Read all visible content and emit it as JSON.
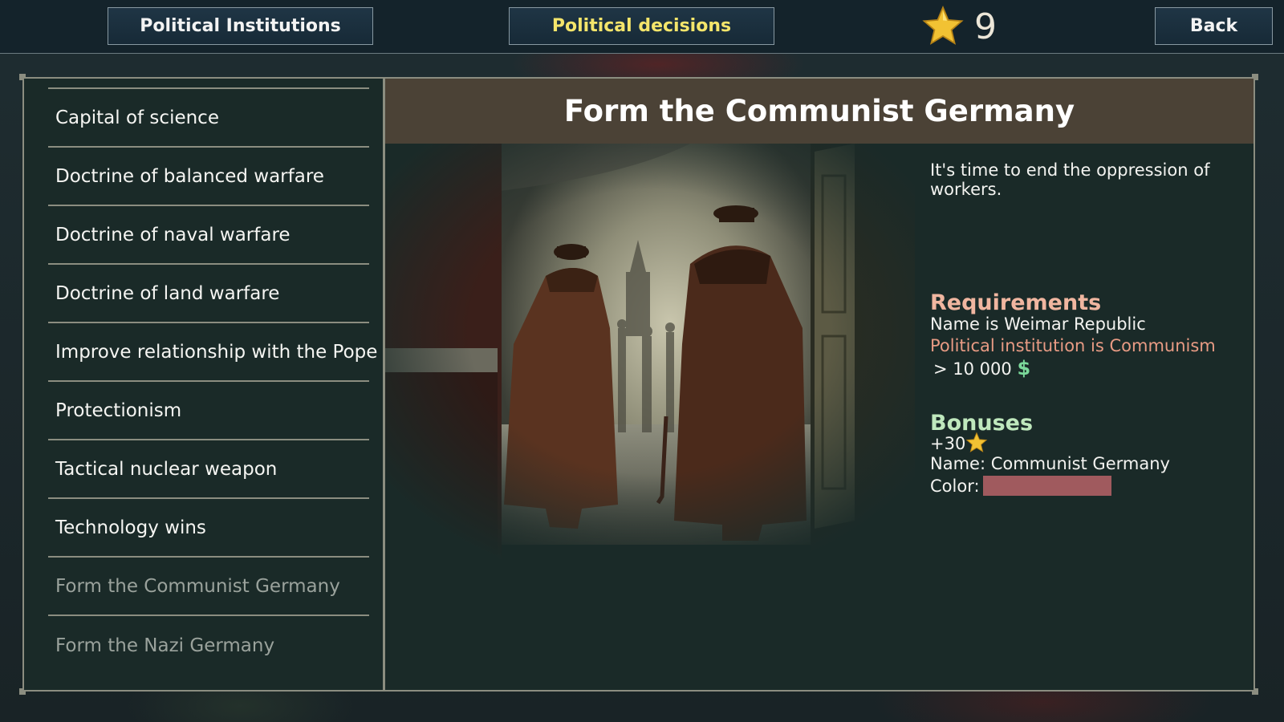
{
  "top_bar": {
    "institutions_label": "Political Institutions",
    "decisions_label": "Political decisions",
    "stars_count": "9",
    "back_label": "Back",
    "star_icon": "star-icon"
  },
  "decisions_list": [
    {
      "label": "Capital of science",
      "available": true
    },
    {
      "label": "Doctrine of balanced warfare",
      "available": true
    },
    {
      "label": "Doctrine of naval warfare",
      "available": true
    },
    {
      "label": "Doctrine of land warfare",
      "available": true
    },
    {
      "label": "Improve relationship with the Pope",
      "available": true
    },
    {
      "label": "Protectionism",
      "available": true
    },
    {
      "label": "Tactical nuclear weapon",
      "available": true
    },
    {
      "label": "Technology wins",
      "available": true
    },
    {
      "label": "Form the Communist Germany",
      "available": false
    },
    {
      "label": "Form the Nazi Germany",
      "available": false
    }
  ],
  "detail": {
    "title": "Form the Communist Germany",
    "description": "It's time to end the oppression of workers.",
    "requirements_title": "Requirements",
    "requirements": {
      "name": "Name is Weimar Republic",
      "institution": "Political institution is Communism",
      "money": "> 10 000",
      "money_symbol": "$"
    },
    "bonuses_title": "Bonuses",
    "bonuses": {
      "stars": "+30",
      "name": "Name: Communist Germany",
      "color_label": "Color:",
      "color_value": "#a05a5e"
    }
  },
  "colors": {
    "accent_yellow": "#f4e56b",
    "requirement_unmet": "#e89b84",
    "requirements_heading": "#f0b6a0",
    "bonuses_heading": "#bfe8bd",
    "money_green": "#7bd99a",
    "header_brown": "#4b4236"
  }
}
